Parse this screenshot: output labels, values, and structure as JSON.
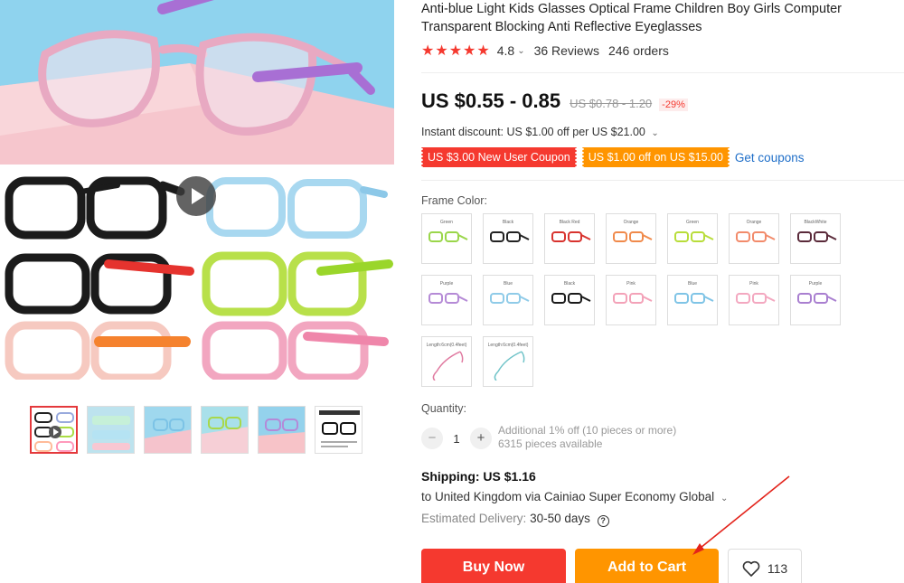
{
  "product": {
    "title": "Anti-blue Light Kids Glasses Optical Frame Children Boy Girls Computer Transparent Blocking Anti Reflective Eyeglasses",
    "stars": "★★★★★",
    "rating": "4.8",
    "reviews": "36 Reviews",
    "orders": "246 orders"
  },
  "price": {
    "current": "US $0.55 - 0.85",
    "original": "US $0.78 - 1.20",
    "discount": "-29%"
  },
  "promo": {
    "instant_discount": "Instant discount: US $1.00 off per US $21.00",
    "coupon_new_user": "US $3.00 New User Coupon",
    "coupon_store": "US $1.00 off on US $15.00",
    "get_coupons": "Get coupons"
  },
  "frame_color": {
    "label": "Frame Color:",
    "options": [
      {
        "name": "Green",
        "color": "#9ad64a"
      },
      {
        "name": "Black",
        "color": "#222222"
      },
      {
        "name": "Black Red",
        "color": "#d8332e"
      },
      {
        "name": "Orange",
        "color": "#f08a4b"
      },
      {
        "name": "Green",
        "color": "#b8dd3a"
      },
      {
        "name": "Orange",
        "color": "#f28b6b"
      },
      {
        "name": "BlackWhite",
        "color": "#5a2a3a"
      },
      {
        "name": "Purple",
        "color": "#b58ad6"
      },
      {
        "name": "Blue",
        "color": "#8fcbe8"
      },
      {
        "name": "Black",
        "color": "#1a1a1a"
      },
      {
        "name": "Pink",
        "color": "#f3a2b8"
      },
      {
        "name": "Blue",
        "color": "#7fc4e6"
      },
      {
        "name": "Pink",
        "color": "#f3a8c0"
      },
      {
        "name": "Purple",
        "color": "#a97fd0"
      },
      {
        "name": "Length:6cm(0.4feet)",
        "color": "#e07aa0",
        "kind": "chain"
      },
      {
        "name": "Length:6cm(0.4feet)",
        "color": "#6fc3c8",
        "kind": "chain"
      }
    ]
  },
  "quantity": {
    "label": "Quantity:",
    "minus": "−",
    "value": "1",
    "plus": "+",
    "additional": "Additional 1% off (10 pieces or more)",
    "available": "6315 pieces available"
  },
  "shipping": {
    "title": "Shipping: US $1.16",
    "destination": "to United Kingdom via Cainiao Super Economy Global",
    "delivery_label": "Estimated Delivery:",
    "delivery_days": "30-50 days",
    "help": "?"
  },
  "actions": {
    "buy_now": "Buy Now",
    "add_to_cart": "Add to Cart",
    "wishlist_count": "113"
  },
  "colors": {
    "accent_red": "#f5392f",
    "accent_orange": "#ff9500",
    "link_blue": "#1e6ec8"
  },
  "icons": {
    "play": "play-icon",
    "wishlist": "heart-icon",
    "help": "question-circle-icon",
    "chevron": "chevron-down-icon"
  }
}
